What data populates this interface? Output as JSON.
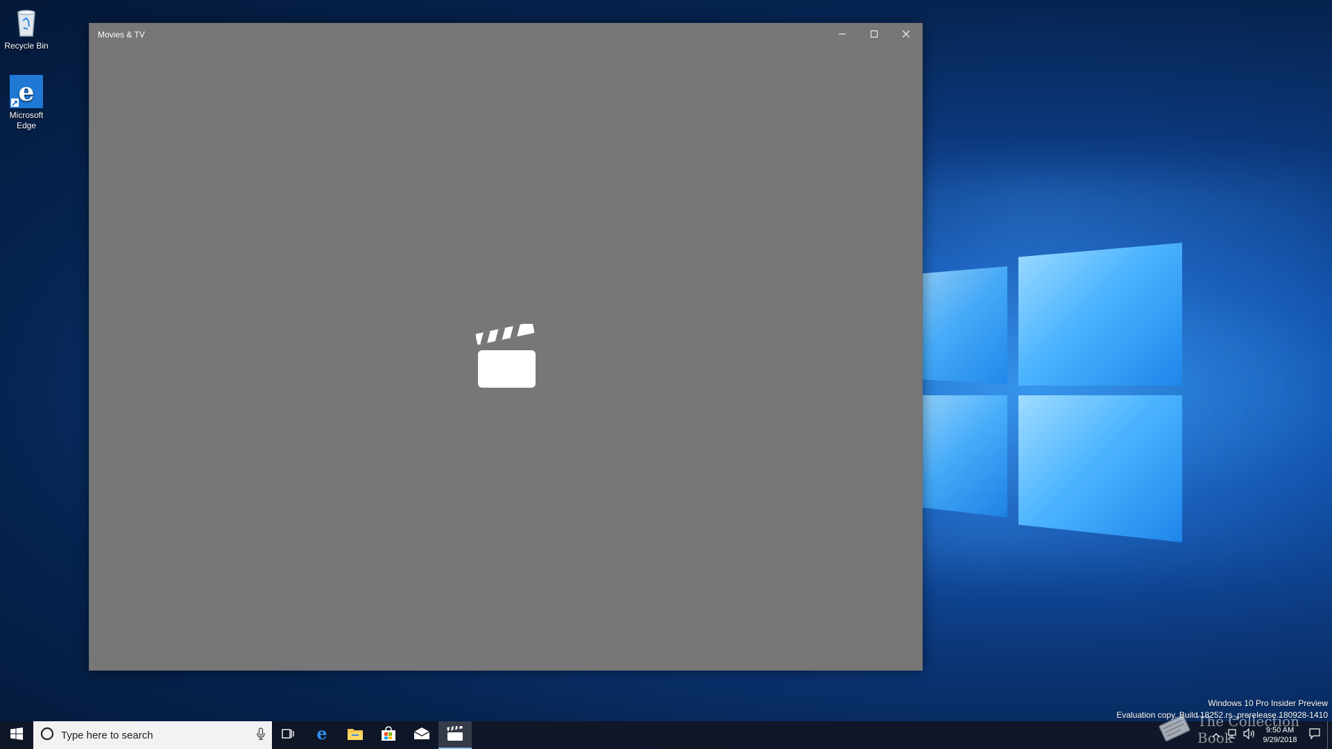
{
  "desktop": {
    "icons": [
      {
        "label": "Recycle Bin",
        "icon": "recycle-bin-icon"
      },
      {
        "label": "Microsoft Edge",
        "icon": "edge-icon"
      }
    ]
  },
  "window": {
    "title": "Movies & TV",
    "controls": {
      "minimize": "minimize-icon",
      "maximize": "maximize-icon",
      "close": "close-icon"
    },
    "background": "#777777",
    "splash_icon": "clapperboard-icon"
  },
  "taskbar": {
    "search_placeholder": "Type here to search",
    "apps": [
      {
        "name": "task-view",
        "icon": "task-view-icon"
      },
      {
        "name": "edge",
        "icon": "edge-icon"
      },
      {
        "name": "file-explorer",
        "icon": "folder-icon"
      },
      {
        "name": "store",
        "icon": "store-icon"
      },
      {
        "name": "mail",
        "icon": "mail-icon"
      },
      {
        "name": "movies-tv",
        "icon": "clapperboard-icon",
        "active": true
      }
    ],
    "clock": {
      "time": "9:50 AM",
      "date": "9/29/2018"
    }
  },
  "watermark": {
    "line1": "Windows 10 Pro Insider Preview",
    "line2": "Evaluation copy. Build 18252.rs_prerelease.180928-1410"
  },
  "overlay": {
    "text": "The Collection Book"
  },
  "colors": {
    "accent": "#0078d7",
    "taskbar": "#10161f",
    "window": "#777777"
  }
}
